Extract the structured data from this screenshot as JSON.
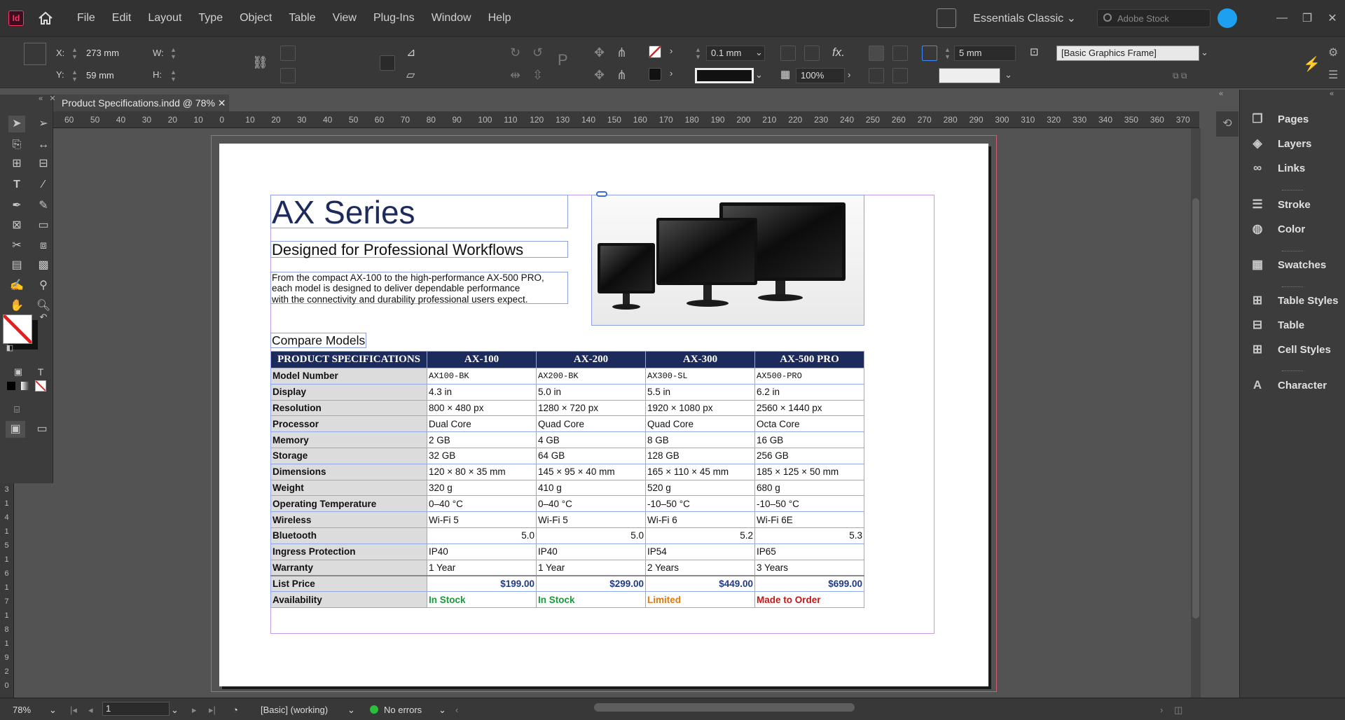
{
  "app": {
    "logo": "Id"
  },
  "menu": [
    "File",
    "Edit",
    "Layout",
    "Type",
    "Object",
    "Table",
    "View",
    "Plug-Ins",
    "Window",
    "Help"
  ],
  "workspace": "Essentials Classic",
  "search_placeholder": "Adobe Stock",
  "control": {
    "x_label": "X:",
    "x_value": "273 mm",
    "y_label": "Y:",
    "y_value": "59 mm",
    "w_label": "W:",
    "h_label": "H:",
    "stroke_weight": "0.1 mm",
    "opacity": "100%",
    "fitting_offset": "5 mm",
    "object_style": "[Basic Graphics Frame]"
  },
  "document_tab": "Product Specifications.indd @ 78%",
  "ruler_marks": [
    "60",
    "50",
    "40",
    "30",
    "20",
    "10",
    "0",
    "10",
    "20",
    "30",
    "40",
    "50",
    "60",
    "70",
    "80",
    "90",
    "100",
    "110",
    "120",
    "130",
    "140",
    "150",
    "160",
    "170",
    "180",
    "190",
    "200",
    "210",
    "220",
    "230",
    "240",
    "250",
    "260",
    "270",
    "280",
    "290",
    "300",
    "310",
    "320",
    "330",
    "340",
    "350",
    "360",
    "370"
  ],
  "vruler_marks": [
    "3",
    "1",
    "4",
    "1",
    "5",
    "1",
    "6",
    "1",
    "7",
    "1",
    "8",
    "1",
    "9",
    "2",
    "0"
  ],
  "doc": {
    "title": "AX Series",
    "subtitle": "Designed for Professional Workflows",
    "intro": [
      "From the compact AX-100 to the high-performance AX-500 PRO,",
      "each model is designed to deliver dependable performance",
      "with the connectivity and durability professional users expect."
    ],
    "compare_heading": "Compare Models"
  },
  "table": {
    "headers": [
      "PRODUCT SPECIFICATIONS",
      "AX-100",
      "AX-200",
      "AX-300",
      "AX-500 PRO"
    ],
    "rows": [
      [
        "Model Number",
        "AX100-BK",
        "AX200-BK",
        "AX300-SL",
        "AX500-PRO"
      ],
      [
        "Display",
        "4.3 in",
        "5.0 in",
        "5.5 in",
        "6.2 in"
      ],
      [
        "Resolution",
        "800 × 480 px",
        "1280 × 720 px",
        "1920 × 1080 px",
        "2560 × 1440 px"
      ],
      [
        "Processor",
        "Dual Core",
        "Quad Core",
        "Quad Core",
        "Octa Core"
      ],
      [
        "Memory",
        "2 GB",
        "4 GB",
        "8 GB",
        "16 GB"
      ],
      [
        "Storage",
        "32 GB",
        "64 GB",
        "128 GB",
        "256 GB"
      ],
      [
        "Dimensions",
        "120 × 80 × 35 mm",
        "145 × 95 × 40 mm",
        "165 × 110 × 45 mm",
        "185 × 125 × 50 mm"
      ],
      [
        "Weight",
        "320 g",
        "410 g",
        "520 g",
        "680 g"
      ],
      [
        "Operating Temperature",
        "0–40 °C",
        "0–40 °C",
        "-10–50 °C",
        "-10–50 °C"
      ],
      [
        "Wireless",
        "Wi-Fi 5",
        "Wi-Fi 5",
        "Wi-Fi 6",
        "Wi-Fi 6E"
      ],
      [
        "Bluetooth",
        "5.0",
        "5.0",
        "5.2",
        "5.3"
      ],
      [
        "Ingress Protection",
        "IP40",
        "IP40",
        "IP54",
        "IP65"
      ],
      [
        "Warranty",
        "1 Year",
        "1 Year",
        "2 Years",
        "3 Years"
      ]
    ],
    "price": [
      "List Price",
      "$199.00",
      "$299.00",
      "$449.00",
      "$699.00"
    ],
    "availability": [
      "Availability",
      "In Stock",
      "In Stock",
      "Limited",
      "Made to Order"
    ],
    "availability_colors": [
      "#1a9a3a",
      "#1a9a3a",
      "#e07a10",
      "#c01818"
    ]
  },
  "panels": [
    "Pages",
    "Layers",
    "Links",
    "Stroke",
    "Color",
    "Swatches",
    "Table Styles",
    "Table",
    "Cell Styles",
    "Character"
  ],
  "status": {
    "zoom": "78%",
    "page": "1",
    "preflight_profile": "[Basic] (working)",
    "errors": "No errors"
  }
}
